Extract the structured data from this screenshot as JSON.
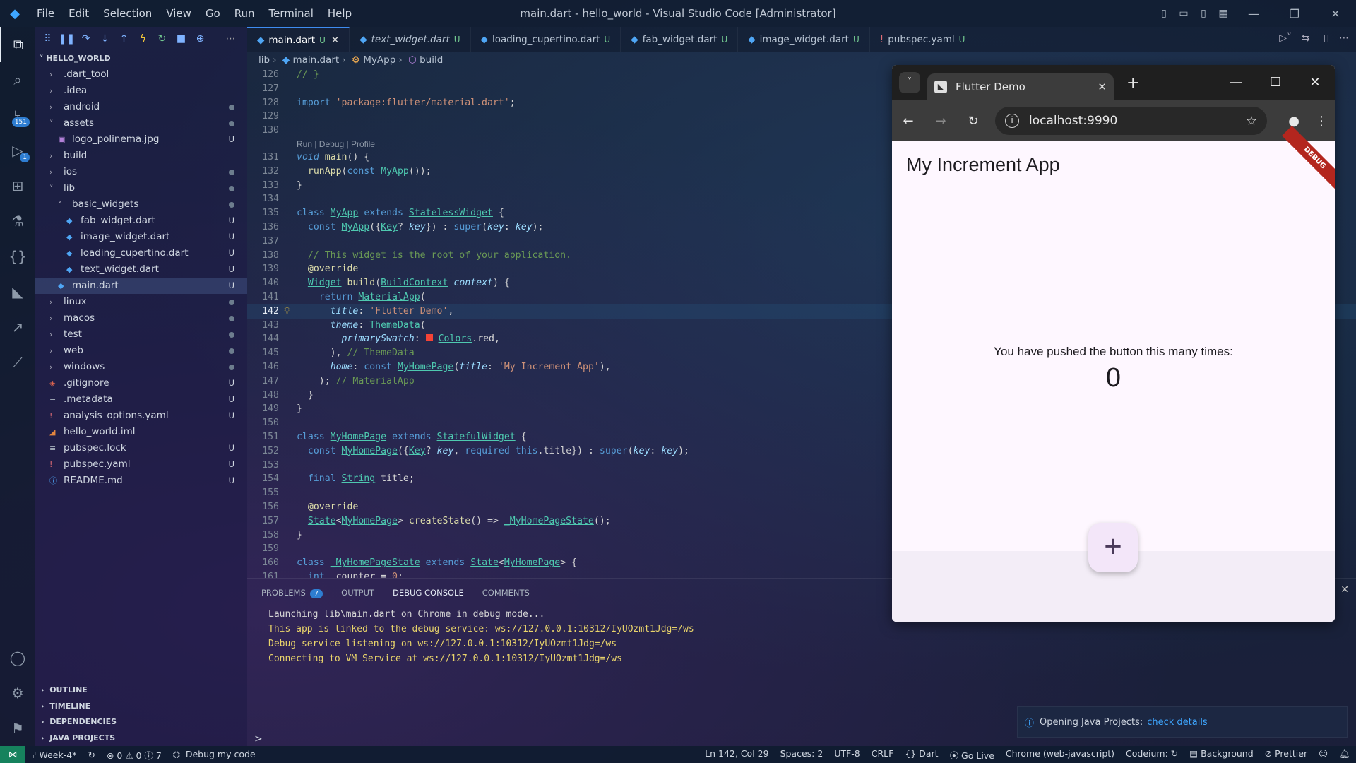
{
  "window": {
    "title": "main.dart - hello_world - Visual Studio Code [Administrator]",
    "menu": [
      "File",
      "Edit",
      "Selection",
      "View",
      "Go",
      "Run",
      "Terminal",
      "Help"
    ]
  },
  "activity_bar": {
    "source_control_badge": "151",
    "run_debug_badge": "1"
  },
  "explorer": {
    "header": "HELLO_WORLD",
    "sections": [
      "OUTLINE",
      "TIMELINE",
      "DEPENDENCIES",
      "JAVA PROJECTS"
    ]
  },
  "tree": [
    {
      "label": ".dart_tool",
      "indent": 1,
      "kind": "folder",
      "status": ""
    },
    {
      "label": ".idea",
      "indent": 1,
      "kind": "folder",
      "status": ""
    },
    {
      "label": "android",
      "indent": 1,
      "kind": "folder",
      "status": "dot"
    },
    {
      "label": "assets",
      "indent": 1,
      "kind": "folder-open",
      "status": "dot"
    },
    {
      "label": "logo_polinema.jpg",
      "indent": 2,
      "kind": "image",
      "status": "U"
    },
    {
      "label": "build",
      "indent": 1,
      "kind": "folder",
      "status": ""
    },
    {
      "label": "ios",
      "indent": 1,
      "kind": "folder",
      "status": "dot"
    },
    {
      "label": "lib",
      "indent": 1,
      "kind": "folder-open",
      "status": "dot"
    },
    {
      "label": "basic_widgets",
      "indent": 2,
      "kind": "folder-open",
      "status": "dot"
    },
    {
      "label": "fab_widget.dart",
      "indent": 3,
      "kind": "dart",
      "status": "U"
    },
    {
      "label": "image_widget.dart",
      "indent": 3,
      "kind": "dart",
      "status": "U"
    },
    {
      "label": "loading_cupertino.dart",
      "indent": 3,
      "kind": "dart",
      "status": "U"
    },
    {
      "label": "text_widget.dart",
      "indent": 3,
      "kind": "dart",
      "status": "U"
    },
    {
      "label": "main.dart",
      "indent": 2,
      "kind": "dart",
      "status": "U",
      "selected": true
    },
    {
      "label": "linux",
      "indent": 1,
      "kind": "folder",
      "status": "dot"
    },
    {
      "label": "macos",
      "indent": 1,
      "kind": "folder",
      "status": "dot"
    },
    {
      "label": "test",
      "indent": 1,
      "kind": "folder",
      "status": "dot"
    },
    {
      "label": "web",
      "indent": 1,
      "kind": "folder",
      "status": "dot"
    },
    {
      "label": "windows",
      "indent": 1,
      "kind": "folder",
      "status": "dot"
    },
    {
      "label": ".gitignore",
      "indent": 1,
      "kind": "git",
      "status": "U"
    },
    {
      "label": ".metadata",
      "indent": 1,
      "kind": "text",
      "status": "U"
    },
    {
      "label": "analysis_options.yaml",
      "indent": 1,
      "kind": "yaml",
      "status": "U"
    },
    {
      "label": "hello_world.iml",
      "indent": 1,
      "kind": "xml",
      "status": ""
    },
    {
      "label": "pubspec.lock",
      "indent": 1,
      "kind": "text",
      "status": "U"
    },
    {
      "label": "pubspec.yaml",
      "indent": 1,
      "kind": "yaml",
      "status": "U"
    },
    {
      "label": "README.md",
      "indent": 1,
      "kind": "info",
      "status": "U"
    }
  ],
  "tabs": [
    {
      "label": "main.dart",
      "mark": "U",
      "active": true,
      "italic": false,
      "icon": "dart"
    },
    {
      "label": "text_widget.dart",
      "mark": "U",
      "active": false,
      "italic": true,
      "icon": "dart"
    },
    {
      "label": "loading_cupertino.dart",
      "mark": "U",
      "active": false,
      "italic": false,
      "icon": "dart"
    },
    {
      "label": "fab_widget.dart",
      "mark": "U",
      "active": false,
      "italic": false,
      "icon": "dart"
    },
    {
      "label": "image_widget.dart",
      "mark": "U",
      "active": false,
      "italic": false,
      "icon": "dart"
    },
    {
      "label": "pubspec.yaml",
      "mark": "U",
      "active": false,
      "italic": false,
      "icon": "yaml"
    }
  ],
  "breadcrumb": [
    "lib",
    "main.dart",
    "MyApp",
    "build"
  ],
  "code": {
    "codelens": "Run | Debug | Profile",
    "current_line": 142,
    "lines": [
      {
        "n": 126,
        "html": "<span class=\"cm\">// }</span>"
      },
      {
        "n": 127,
        "html": ""
      },
      {
        "n": 128,
        "html": "<span class=\"kw\">import</span> <span class=\"str\">'package:flutter/material.dart'</span>;"
      },
      {
        "n": 129,
        "html": ""
      },
      {
        "n": 130,
        "html": ""
      },
      {
        "n": 131,
        "html": "<span class=\"it\">void</span> <span class=\"fn\">main</span>() {",
        "lens": true
      },
      {
        "n": 132,
        "html": "  <span class=\"fn\">runApp</span>(<span class=\"kw\">const</span> <span class=\"cls\">MyApp</span>());"
      },
      {
        "n": 133,
        "html": "}"
      },
      {
        "n": 134,
        "html": ""
      },
      {
        "n": 135,
        "html": "<span class=\"kw\">class</span> <span class=\"cls\">MyApp</span> <span class=\"kw\">extends</span> <span class=\"cls\">StatelessWidget</span> {"
      },
      {
        "n": 136,
        "html": "  <span class=\"kw\">const</span> <span class=\"cls\">MyApp</span>({<span class=\"cls\">Key</span>? <span class=\"prm\">key</span>}) : <span class=\"kw\">super</span>(<span class=\"prm\">key</span>: <span class=\"prm\">key</span>);"
      },
      {
        "n": 137,
        "html": ""
      },
      {
        "n": 138,
        "html": "  <span class=\"cm\">// This widget is the root of your application.</span>"
      },
      {
        "n": 139,
        "html": "  <span class=\"fn\">@override</span>"
      },
      {
        "n": 140,
        "html": "  <span class=\"cls\">Widget</span> <span class=\"fn\">build</span>(<span class=\"cls\">BuildContext</span> <span class=\"prm\">context</span>) {"
      },
      {
        "n": 141,
        "html": "    <span class=\"kw\">return</span> <span class=\"cls\">MaterialApp</span>("
      },
      {
        "n": 142,
        "html": "      <span class=\"prm\">title</span>: <span class=\"str\">'Flutter Demo'</span>,",
        "cur": true
      },
      {
        "n": 143,
        "html": "      <span class=\"prm\">theme</span>: <span class=\"cls\">ThemeData</span>("
      },
      {
        "n": 144,
        "html": "        <span class=\"prm\">primarySwatch</span>: <span style=\"display:inline-block;width:10px;height:10px;background:#f44336;\"></span> <span class=\"cls\">Colors</span>.red,"
      },
      {
        "n": 145,
        "html": "      ), <span class=\"cm\">// ThemeData</span>"
      },
      {
        "n": 146,
        "html": "      <span class=\"prm\">home</span>: <span class=\"kw\">const</span> <span class=\"cls\">MyHomePage</span>(<span class=\"prm\">title</span>: <span class=\"str\">'My Increment App'</span>),"
      },
      {
        "n": 147,
        "html": "    ); <span class=\"cm\">// MaterialApp</span>"
      },
      {
        "n": 148,
        "html": "  }"
      },
      {
        "n": 149,
        "html": "}"
      },
      {
        "n": 150,
        "html": ""
      },
      {
        "n": 151,
        "html": "<span class=\"kw\">class</span> <span class=\"cls\">MyHomePage</span> <span class=\"kw\">extends</span> <span class=\"cls\">StatefulWidget</span> {"
      },
      {
        "n": 152,
        "html": "  <span class=\"kw\">const</span> <span class=\"cls\">MyHomePage</span>({<span class=\"cls\">Key</span>? <span class=\"prm\">key</span>, <span class=\"kw\">required</span> <span class=\"kw\">this</span>.title}) : <span class=\"kw\">super</span>(<span class=\"prm\">key</span>: <span class=\"prm\">key</span>);"
      },
      {
        "n": 153,
        "html": ""
      },
      {
        "n": 154,
        "html": "  <span class=\"kw\">final</span> <span class=\"cls\">String</span> title;"
      },
      {
        "n": 155,
        "html": ""
      },
      {
        "n": 156,
        "html": "  <span class=\"fn\">@override</span>"
      },
      {
        "n": 157,
        "html": "  <span class=\"cls\">State</span>&lt;<span class=\"cls\">MyHomePage</span>&gt; <span class=\"fn\">createState</span>() =&gt; <span class=\"cls\">_MyHomePageState</span>();"
      },
      {
        "n": 158,
        "html": "}"
      },
      {
        "n": 159,
        "html": ""
      },
      {
        "n": 160,
        "html": "<span class=\"kw\">class</span> <span class=\"cls\">_MyHomePageState</span> <span class=\"kw\">extends</span> <span class=\"cls\">State</span>&lt;<span class=\"cls\">MyHomePage</span>&gt; {"
      },
      {
        "n": 161,
        "html": "  <span class=\"kw\">int</span> _counter = <span class=\"str\">0</span>;"
      }
    ]
  },
  "panel": {
    "tabs": [
      {
        "label": "PROBLEMS",
        "badge": "7",
        "active": false
      },
      {
        "label": "OUTPUT",
        "active": false
      },
      {
        "label": "DEBUG CONSOLE",
        "active": true
      },
      {
        "label": "COMMENTS",
        "active": false
      }
    ],
    "console": [
      {
        "text": "Launching lib\\main.dart on Chrome in debug mode...",
        "white": true
      },
      {
        "text": "This app is linked to the debug service: ws://127.0.0.1:10312/IyUOzmt1Jdg=/ws",
        "white": false
      },
      {
        "text": "Debug service listening on ws://127.0.0.1:10312/IyUOzmt1Jdg=/ws",
        "white": false
      },
      {
        "text": "Connecting to VM Service at ws://127.0.0.1:10312/IyUOzmt1Jdg=/ws",
        "white": false
      }
    ],
    "prompt": ">"
  },
  "notification": {
    "text": "Opening Java Projects:",
    "link": "check details"
  },
  "statusbar": {
    "branch": "Week-4*",
    "problems": "0",
    "warnings": "0",
    "infos": "7",
    "debug": "Debug my code",
    "position": "Ln 142, Col 29",
    "spaces": "Spaces: 2",
    "encoding": "UTF-8",
    "eol": "CRLF",
    "language": "Dart",
    "golive": "Go Live",
    "device": "Chrome (web-javascript)",
    "codeium": "Codeium:",
    "background": "Background",
    "prettier": "Prettier"
  },
  "browser": {
    "tab_title": "Flutter Demo",
    "url": "localhost:9990",
    "app": {
      "title": "My Increment App",
      "label": "You have pushed the button this many times:",
      "count": "0",
      "debug_banner": "DEBUG",
      "fab_icon": "+"
    }
  }
}
